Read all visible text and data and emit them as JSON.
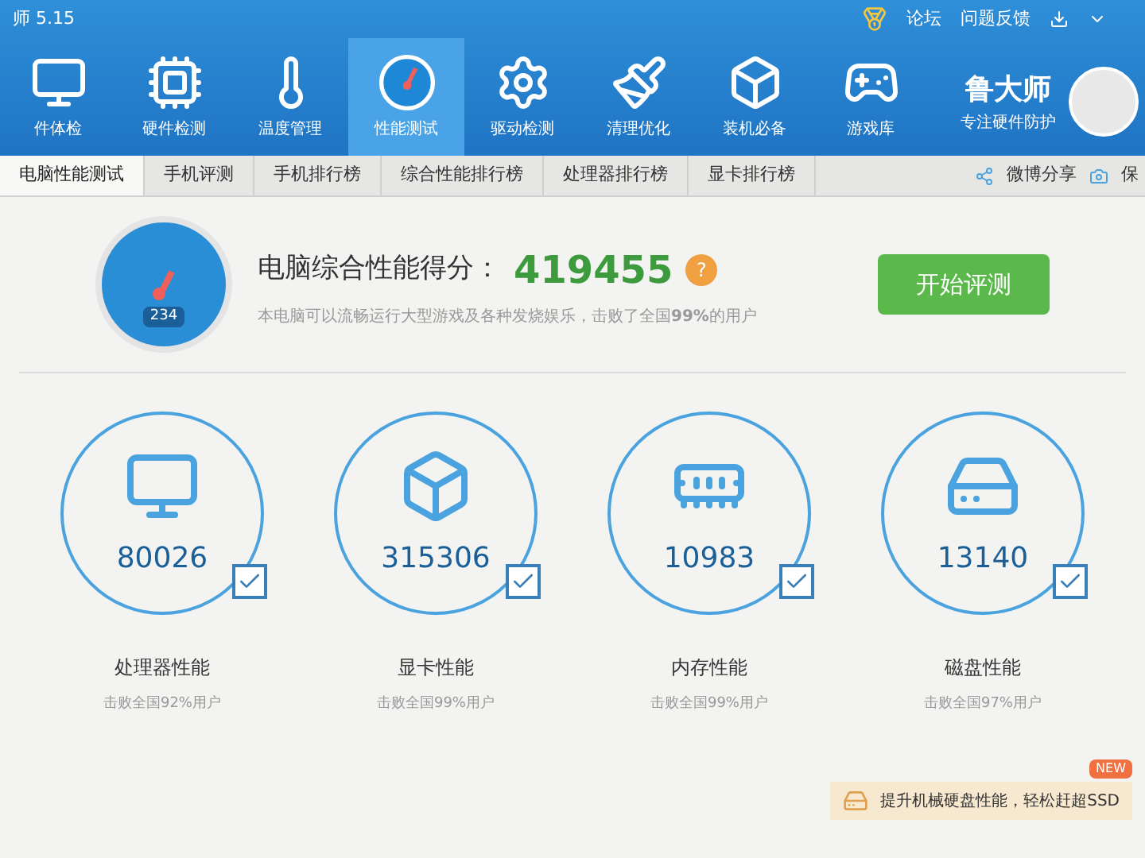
{
  "window": {
    "title": "师 5.15"
  },
  "nav": [
    {
      "label": "件体检",
      "kind": "monitor",
      "selected": false
    },
    {
      "label": "硬件检测",
      "kind": "board",
      "selected": false
    },
    {
      "label": "温度管理",
      "kind": "thermo",
      "selected": false
    },
    {
      "label": "性能测试",
      "kind": "gauge",
      "selected": true
    },
    {
      "label": "驱动检测",
      "kind": "gear",
      "selected": false
    },
    {
      "label": "清理优化",
      "kind": "broom",
      "selected": false
    },
    {
      "label": "装机必备",
      "kind": "cube",
      "selected": false
    },
    {
      "label": "游戏库",
      "kind": "gamepad",
      "selected": false
    }
  ],
  "top_links": [
    "论坛",
    "问题反馈"
  ],
  "brand": {
    "name": "鲁大师",
    "slogan": "专注硬件防护"
  },
  "tabs": [
    {
      "label": "电脑性能测试",
      "selected": true
    },
    {
      "label": "手机评测",
      "selected": false
    },
    {
      "label": "手机排行榜",
      "selected": false
    },
    {
      "label": "综合性能排行榜",
      "selected": false
    },
    {
      "label": "处理器排行榜",
      "selected": false
    },
    {
      "label": "显卡排行榜",
      "selected": false
    }
  ],
  "share": [
    "微博分享",
    "保"
  ],
  "summary": {
    "gauge_text": "234",
    "title": "电脑综合性能得分：",
    "score": "419455",
    "help": "?",
    "description": "本电脑可以流畅运行大型游戏及各种发烧娱乐，击败了全国**99%**的用户",
    "button": "开始评测"
  },
  "scores": [
    {
      "kind": "cpu",
      "score": "80026",
      "checked": true,
      "name": "处理器性能",
      "rank": "击败全国92%用户"
    },
    {
      "kind": "gpu",
      "score": "315306",
      "checked": true,
      "name": "显卡性能",
      "rank": "击败全国99%用户"
    },
    {
      "kind": "ram",
      "score": "10983",
      "checked": true,
      "name": "内存性能",
      "rank": "击败全国99%用户"
    },
    {
      "kind": "disk",
      "score": "13140",
      "checked": true,
      "name": "磁盘性能",
      "rank": "击败全国97%用户"
    }
  ],
  "promo": {
    "badge": "NEW",
    "text": "提升机械硬盘性能，轻松赶超SSD"
  }
}
